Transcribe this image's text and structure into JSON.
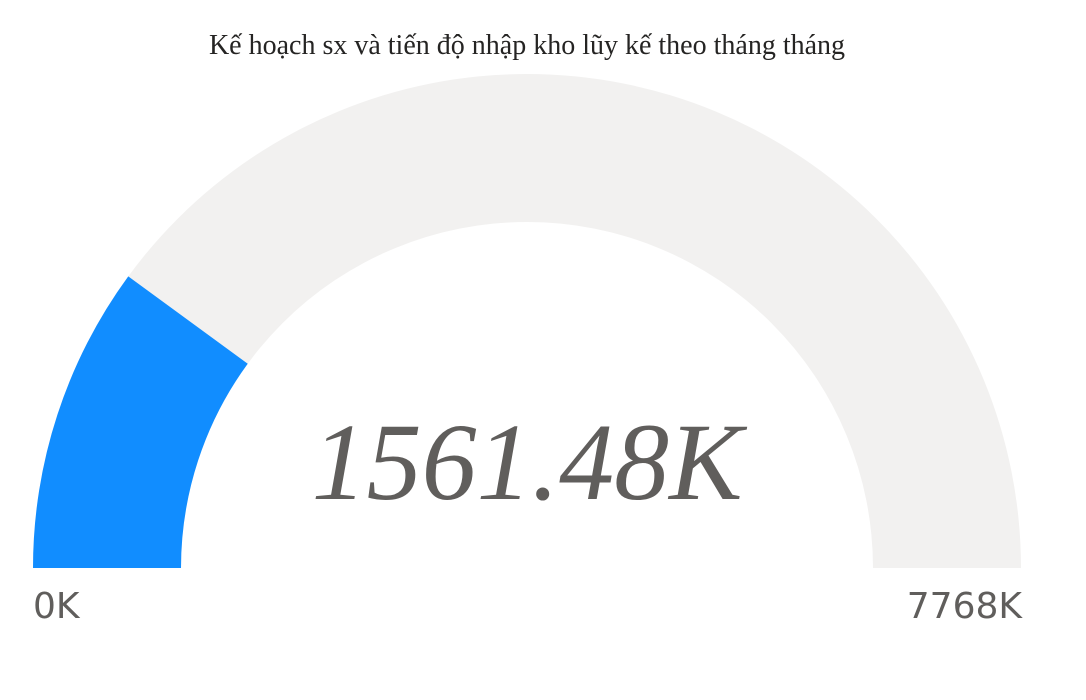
{
  "chart_data": {
    "type": "gauge",
    "title": "Kế hoạch sx và tiến độ nhập kho lũy kế theo tháng tháng",
    "value": 1561.48,
    "value_label": "1561.48K",
    "min": 0,
    "max": 7768,
    "min_label": "0K",
    "max_label": "7768K",
    "unit": "K"
  },
  "colors": {
    "fill": "#118dff",
    "track": "#f2f1f0",
    "text": "#605e5c",
    "title": "#252423"
  }
}
